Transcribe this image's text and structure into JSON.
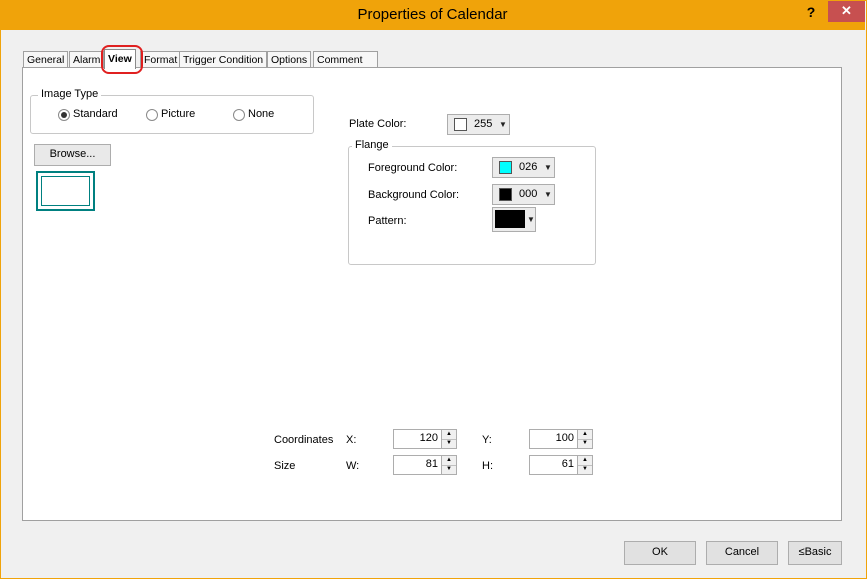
{
  "window": {
    "title": "Properties of Calendar",
    "help_label": "?",
    "close_label": "✕"
  },
  "tabs": [
    {
      "label": "General"
    },
    {
      "label": "Alarm"
    },
    {
      "label": "View"
    },
    {
      "label": "Format"
    },
    {
      "label": "Trigger Condition"
    },
    {
      "label": "Options"
    },
    {
      "label": "Comment"
    }
  ],
  "active_tab": "View",
  "image_type": {
    "group_label": "Image Type",
    "options": [
      {
        "label": "Standard",
        "checked": true
      },
      {
        "label": "Picture",
        "checked": false
      },
      {
        "label": "None",
        "checked": false
      }
    ]
  },
  "browse_label": "Browse...",
  "plate_color": {
    "label": "Plate Color:",
    "value": "255",
    "swatch": "#ffffff"
  },
  "flange": {
    "group_label": "Flange",
    "foreground": {
      "label": "Foreground Color:",
      "value": "026",
      "swatch": "#00ffff"
    },
    "background": {
      "label": "Background Color:",
      "value": "000",
      "swatch": "#000000"
    },
    "pattern": {
      "label": "Pattern:",
      "swatch": "#000000"
    }
  },
  "coordinates": {
    "label": "Coordinates",
    "x_label": "X:",
    "x_value": "120",
    "y_label": "Y:",
    "y_value": "100"
  },
  "size": {
    "label": "Size",
    "w_label": "W:",
    "w_value": "81",
    "h_label": "H:",
    "h_value": "61"
  },
  "footer": {
    "ok": "OK",
    "cancel": "Cancel",
    "basic": "≤Basic"
  },
  "colors": {
    "titlebar": "#f0a30a",
    "close": "#c75050",
    "highlight": "#e02020"
  }
}
